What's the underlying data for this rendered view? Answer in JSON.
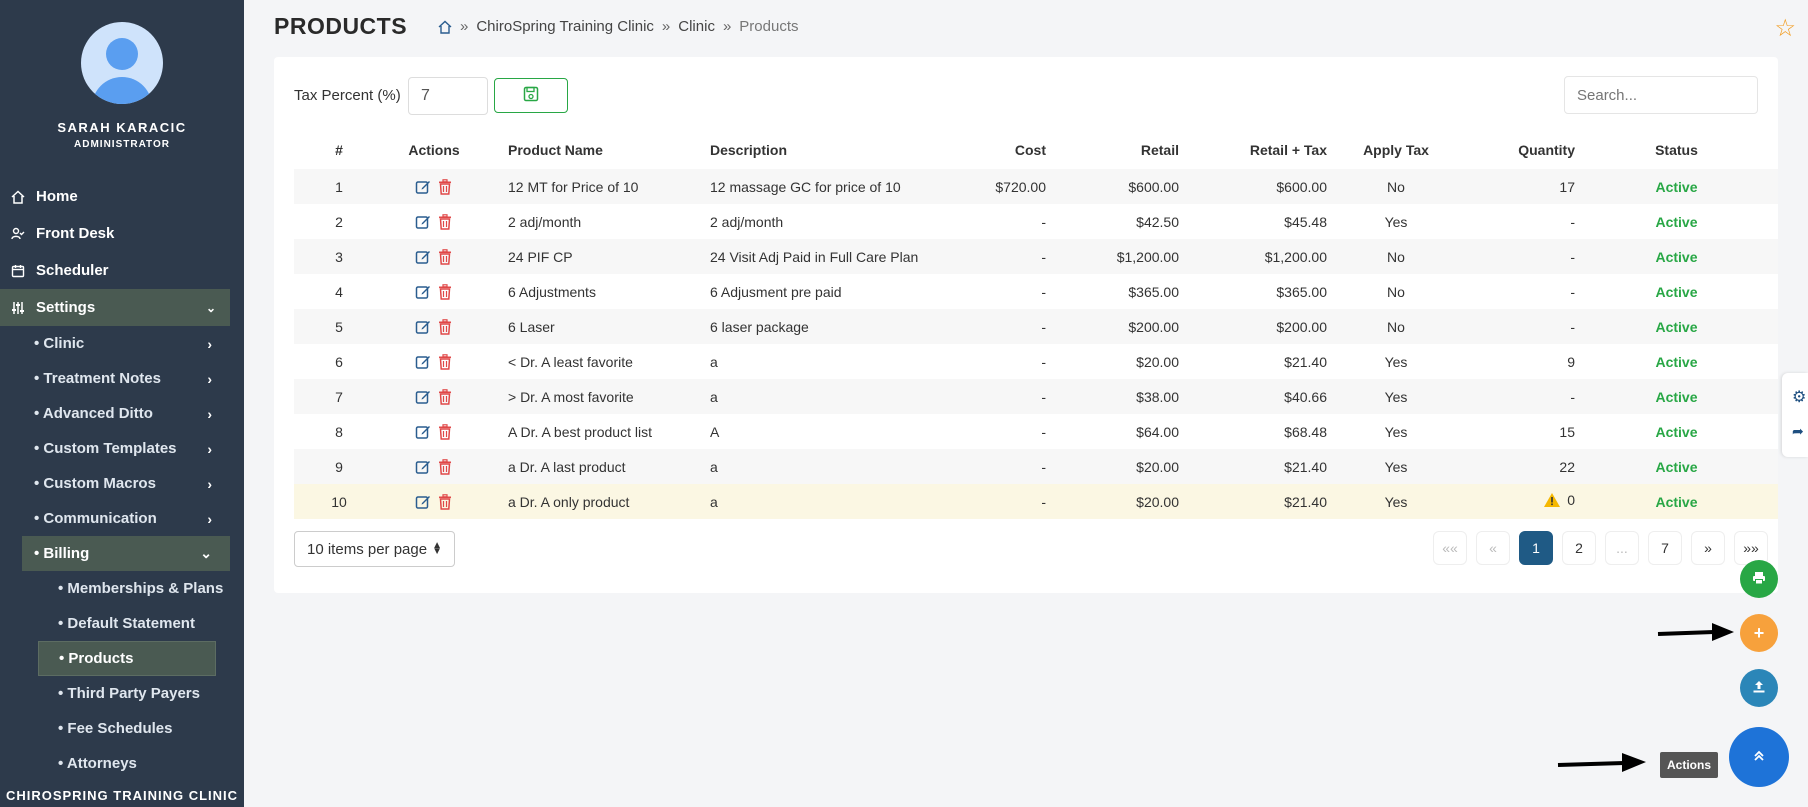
{
  "sidebar": {
    "profile": {
      "name": "SARAH KARACIC",
      "role": "ADMINISTRATOR"
    },
    "nav": {
      "home": "Home",
      "front_desk": "Front Desk",
      "scheduler": "Scheduler",
      "settings": "Settings"
    },
    "settings_items": {
      "clinic": "• Clinic",
      "treatment_notes": "• Treatment Notes",
      "advanced_ditto": "• Advanced Ditto",
      "custom_templates": "• Custom Templates",
      "custom_macros": "• Custom Macros",
      "communication": "• Communication",
      "billing": "• Billing"
    },
    "billing_items": {
      "memberships": "• Memberships & Plans",
      "default_statement": "• Default Statement",
      "products": "• Products",
      "third_party": "• Third Party Payers",
      "fee_schedules": "• Fee Schedules",
      "attorneys": "• Attorneys"
    },
    "footer": "CHIROSPRING TRAINING CLINIC"
  },
  "header": {
    "title": "PRODUCTS",
    "breadcrumb": {
      "clinic_name": "ChiroSpring Training Clinic",
      "section": "Clinic",
      "current": "Products",
      "sep": "»"
    }
  },
  "toolbar": {
    "tax_label": "Tax Percent (%)",
    "tax_value": "7",
    "search_placeholder": "Search..."
  },
  "table": {
    "headers": {
      "num": "#",
      "actions": "Actions",
      "name": "Product Name",
      "description": "Description",
      "cost": "Cost",
      "retail": "Retail",
      "retail_tax": "Retail + Tax",
      "apply_tax": "Apply Tax",
      "quantity": "Quantity",
      "status": "Status"
    },
    "rows": [
      {
        "num": "1",
        "name": "12 MT for Price of 10",
        "description": "12 massage GC for price of 10",
        "cost": "$720.00",
        "retail": "$600.00",
        "retail_tax": "$600.00",
        "apply_tax": "No",
        "quantity": "17",
        "status": "Active"
      },
      {
        "num": "2",
        "name": "2 adj/month",
        "description": "2 adj/month",
        "cost": "-",
        "retail": "$42.50",
        "retail_tax": "$45.48",
        "apply_tax": "Yes",
        "quantity": "-",
        "status": "Active"
      },
      {
        "num": "3",
        "name": "24 PIF CP",
        "description": "24 Visit Adj Paid in Full Care Plan",
        "cost": "-",
        "retail": "$1,200.00",
        "retail_tax": "$1,200.00",
        "apply_tax": "No",
        "quantity": "-",
        "status": "Active"
      },
      {
        "num": "4",
        "name": "6 Adjustments",
        "description": "6 Adjusment pre paid",
        "cost": "-",
        "retail": "$365.00",
        "retail_tax": "$365.00",
        "apply_tax": "No",
        "quantity": "-",
        "status": "Active"
      },
      {
        "num": "5",
        "name": "6 Laser",
        "description": "6 laser package",
        "cost": "-",
        "retail": "$200.00",
        "retail_tax": "$200.00",
        "apply_tax": "No",
        "quantity": "-",
        "status": "Active"
      },
      {
        "num": "6",
        "name": "< Dr. A least favorite",
        "description": "a",
        "cost": "-",
        "retail": "$20.00",
        "retail_tax": "$21.40",
        "apply_tax": "Yes",
        "quantity": "9",
        "status": "Active"
      },
      {
        "num": "7",
        "name": "> Dr. A most favorite",
        "description": "a",
        "cost": "-",
        "retail": "$38.00",
        "retail_tax": "$40.66",
        "apply_tax": "Yes",
        "quantity": "-",
        "status": "Active"
      },
      {
        "num": "8",
        "name": "A Dr. A best product list",
        "description": "A",
        "cost": "-",
        "retail": "$64.00",
        "retail_tax": "$68.48",
        "apply_tax": "Yes",
        "quantity": "15",
        "status": "Active"
      },
      {
        "num": "9",
        "name": "a Dr. A last product",
        "description": "a",
        "cost": "-",
        "retail": "$20.00",
        "retail_tax": "$21.40",
        "apply_tax": "Yes",
        "quantity": "22",
        "status": "Active"
      },
      {
        "num": "10",
        "name": "a Dr. A only product",
        "description": "a",
        "cost": "-",
        "retail": "$20.00",
        "retail_tax": "$21.40",
        "apply_tax": "Yes",
        "quantity": "0",
        "status": "Active"
      }
    ]
  },
  "pagination": {
    "per_page": "10 items per page",
    "first": "««",
    "prev": "«",
    "pages": [
      "1",
      "2",
      "...",
      "7"
    ],
    "current": "1",
    "next": "»",
    "last": "»»"
  },
  "fab": {
    "actions_tooltip": "Actions"
  },
  "colors": {
    "sidebar_bg": "#2d3a4b",
    "sidebar_active": "#4a5a52",
    "status_active": "#28a745",
    "pager_current": "#1f5a85",
    "fab_print": "#28a745",
    "fab_add": "#f7a13c",
    "fab_upload": "#2b86b8",
    "fab_actions": "#1e73d8",
    "delete_icon": "#e04848",
    "edit_icon": "#2a5d8f"
  }
}
